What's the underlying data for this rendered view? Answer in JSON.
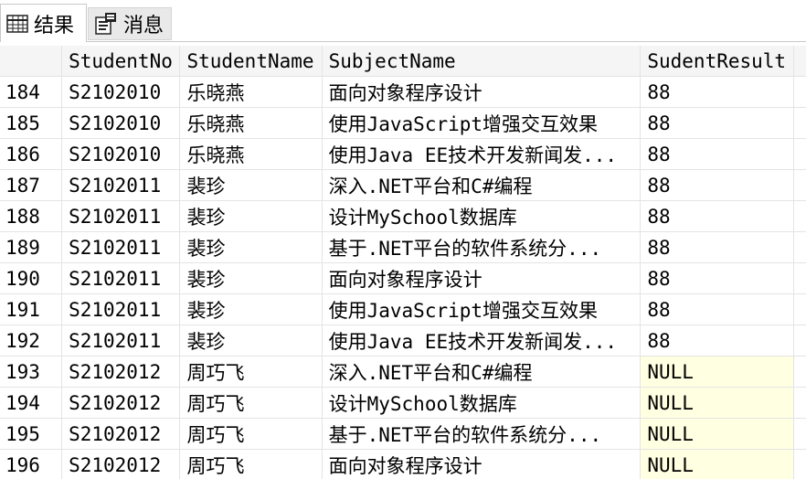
{
  "tabs": [
    {
      "label": "结果",
      "icon": "grid-icon",
      "active": true
    },
    {
      "label": "消息",
      "icon": "messages-icon",
      "active": false
    }
  ],
  "columns": [
    "",
    "StudentNo",
    "StudentName",
    "SubjectName",
    "SudentResult"
  ],
  "rows": [
    {
      "rn": "184",
      "no": "S2102010",
      "name": "乐晓燕",
      "subject": "面向对象程序设计",
      "result": "88"
    },
    {
      "rn": "185",
      "no": "S2102010",
      "name": "乐晓燕",
      "subject": "使用JavaScript增强交互效果",
      "result": "88"
    },
    {
      "rn": "186",
      "no": "S2102010",
      "name": "乐晓燕",
      "subject": "使用Java EE技术开发新闻发...",
      "result": "88"
    },
    {
      "rn": "187",
      "no": "S2102011",
      "name": "裴珍",
      "subject": "深入.NET平台和C#编程",
      "result": "88"
    },
    {
      "rn": "188",
      "no": "S2102011",
      "name": "裴珍",
      "subject": "设计MySchool数据库",
      "result": "88"
    },
    {
      "rn": "189",
      "no": "S2102011",
      "name": "裴珍",
      "subject": "基于.NET平台的软件系统分...",
      "result": "88"
    },
    {
      "rn": "190",
      "no": "S2102011",
      "name": "裴珍",
      "subject": "面向对象程序设计",
      "result": "88"
    },
    {
      "rn": "191",
      "no": "S2102011",
      "name": "裴珍",
      "subject": "使用JavaScript增强交互效果",
      "result": "88"
    },
    {
      "rn": "192",
      "no": "S2102011",
      "name": "裴珍",
      "subject": "使用Java EE技术开发新闻发...",
      "result": "88"
    },
    {
      "rn": "193",
      "no": "S2102012",
      "name": "周巧飞",
      "subject": "深入.NET平台和C#编程",
      "result": "NULL"
    },
    {
      "rn": "194",
      "no": "S2102012",
      "name": "周巧飞",
      "subject": "设计MySchool数据库",
      "result": "NULL"
    },
    {
      "rn": "195",
      "no": "S2102012",
      "name": "周巧飞",
      "subject": "基于.NET平台的软件系统分...",
      "result": "NULL"
    },
    {
      "rn": "196",
      "no": "S2102012",
      "name": "周巧飞",
      "subject": "面向对象程序设计",
      "result": "NULL"
    }
  ],
  "colors": {
    "null_cell": "#ffffe1",
    "header_bg": "#f5f5f5"
  }
}
